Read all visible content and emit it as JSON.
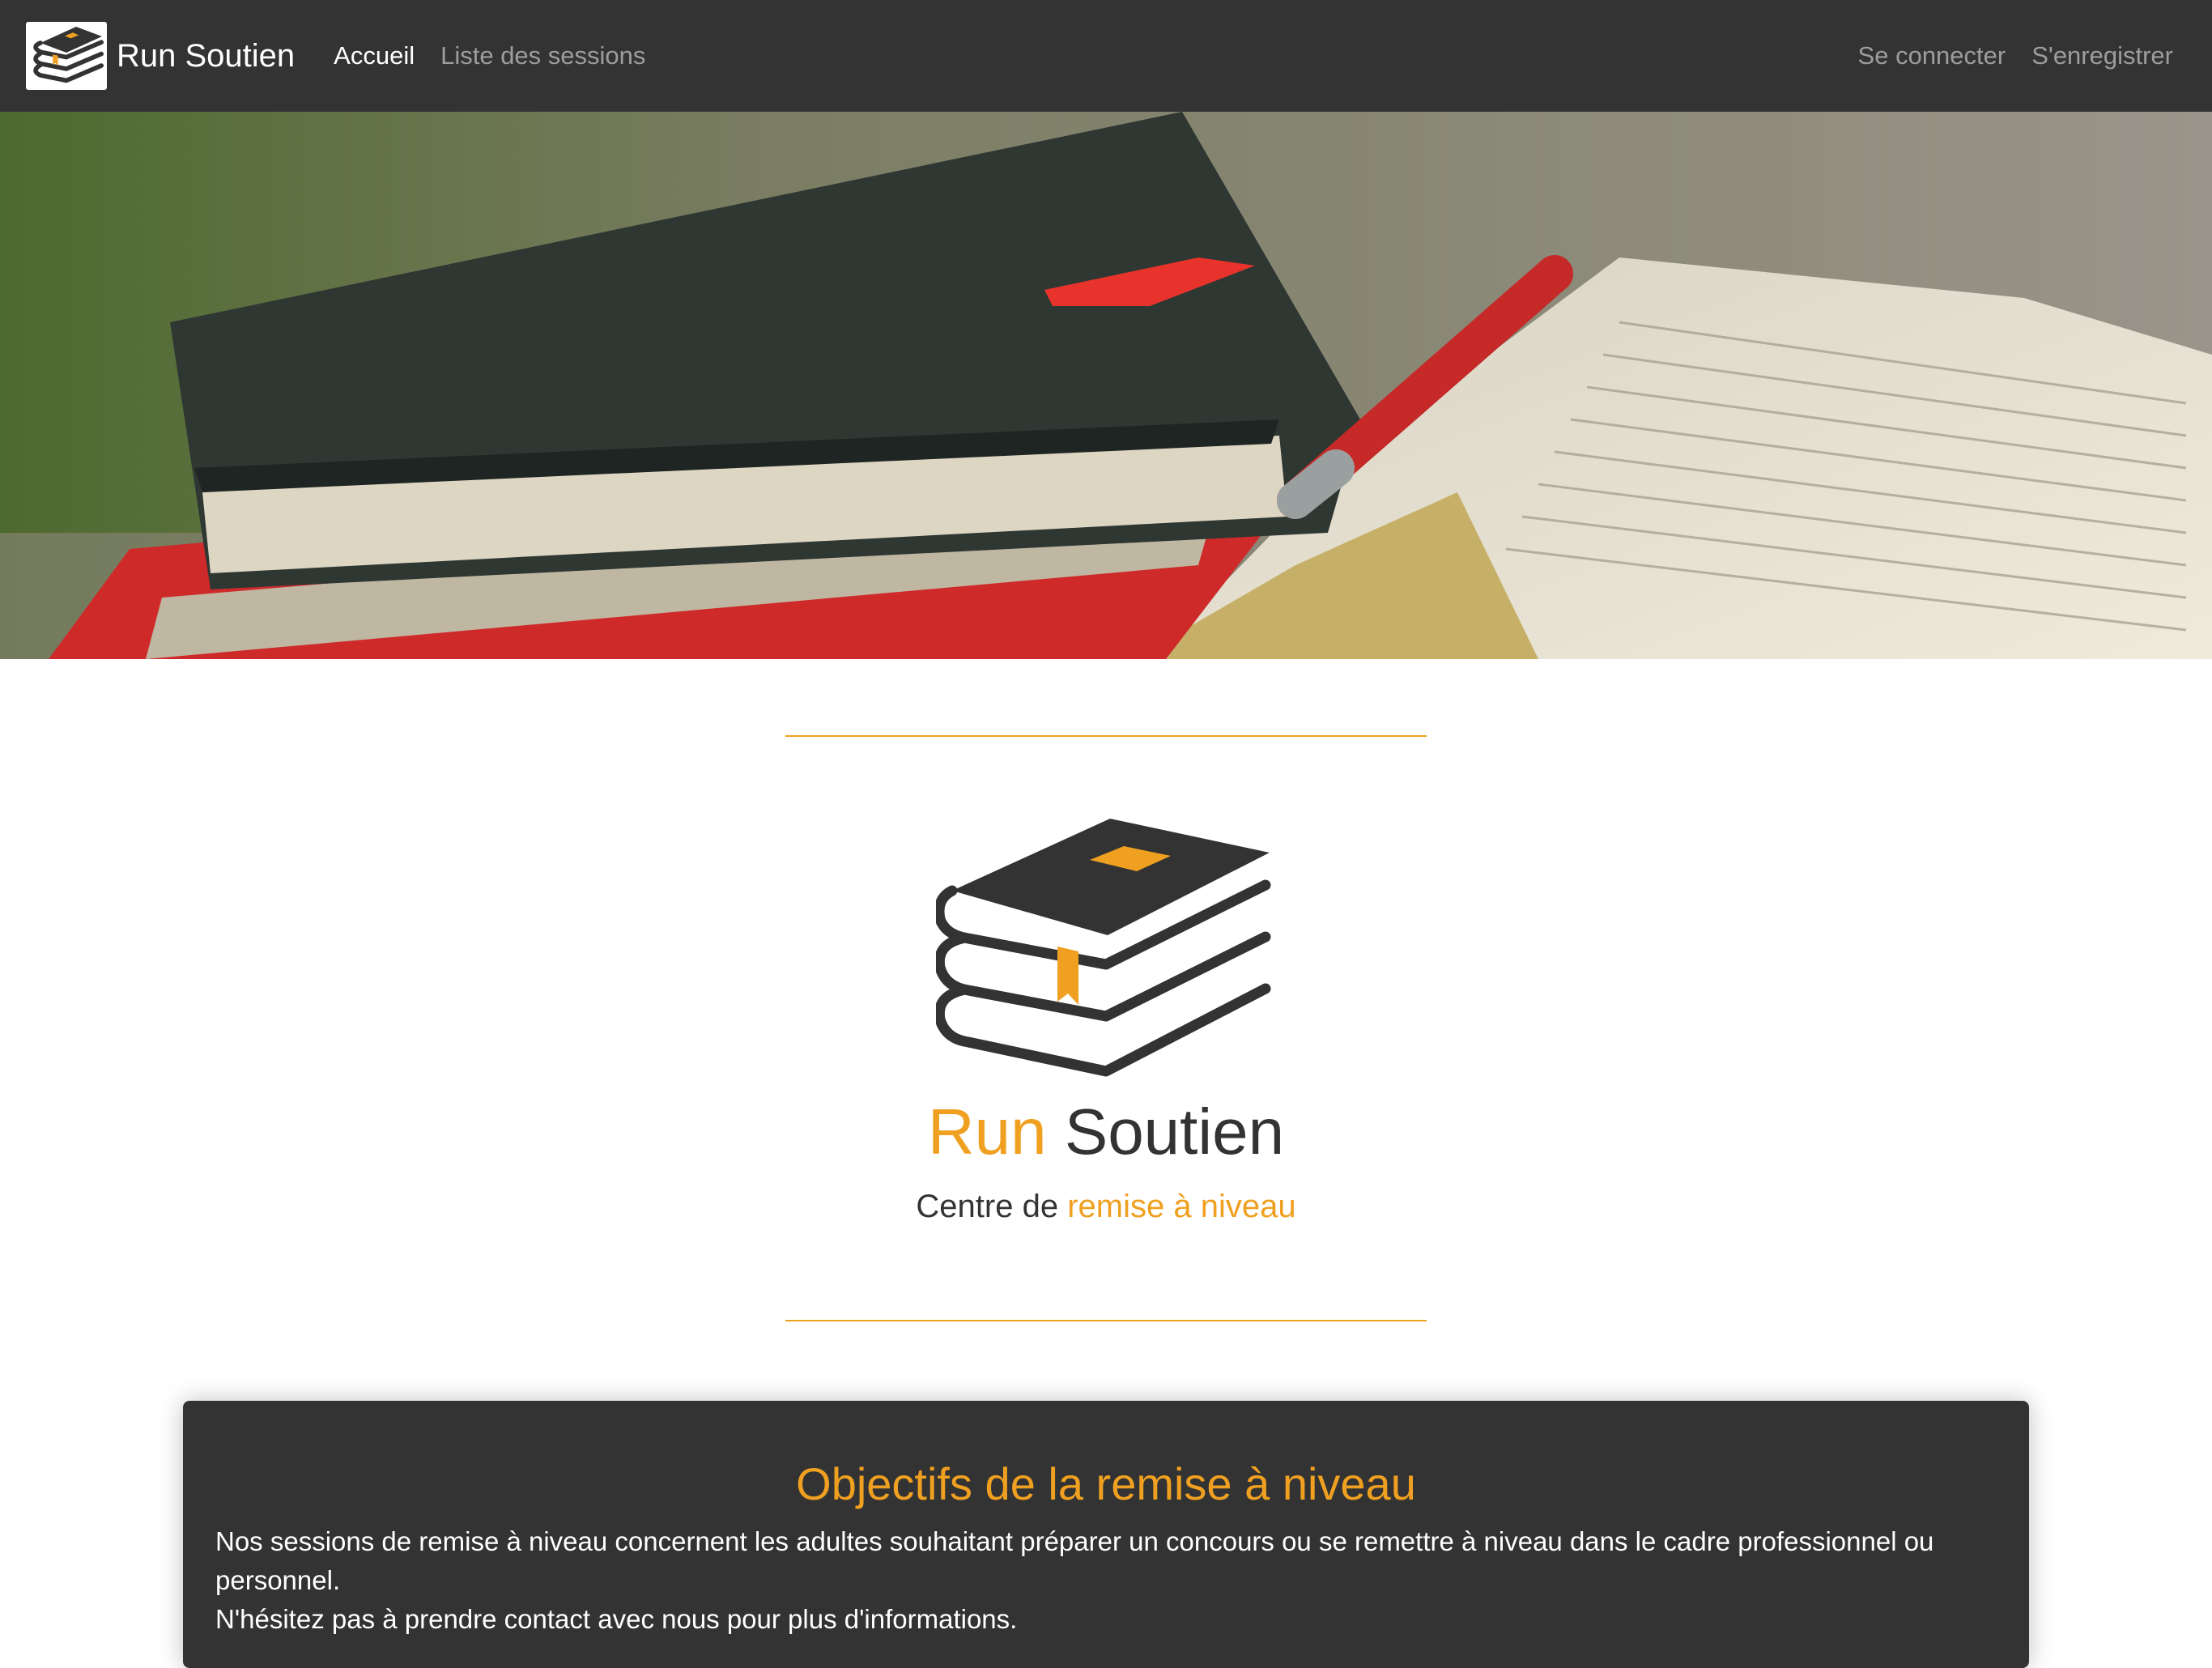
{
  "navbar": {
    "brand": "Run Soutien",
    "links_left": [
      "Accueil",
      "Liste des sessions"
    ],
    "links_right": [
      "Se connecter",
      "S'enregistrer"
    ],
    "logo_icon": "book-stack-icon"
  },
  "hero": {
    "image": "books-pen-photo"
  },
  "main": {
    "title_accent": "Run",
    "title_rest": "Soutien",
    "subtitle_prefix": "Centre de",
    "subtitle_accent": "remise à niveau",
    "logo_icon": "book-stack-icon"
  },
  "objectives": {
    "title": "Objectifs de la remise à niveau",
    "line1": "Nos sessions de remise à niveau concernent les adultes souhaitant préparer un concours ou se remettre à niveau dans le cadre professionnel ou personnel.",
    "line2": "N'hésitez pas à prendre contact avec nous pour plus d'informations."
  },
  "colors": {
    "accent": "#f0a020",
    "dark": "#333333",
    "muted_link": "#9d9d9d"
  }
}
